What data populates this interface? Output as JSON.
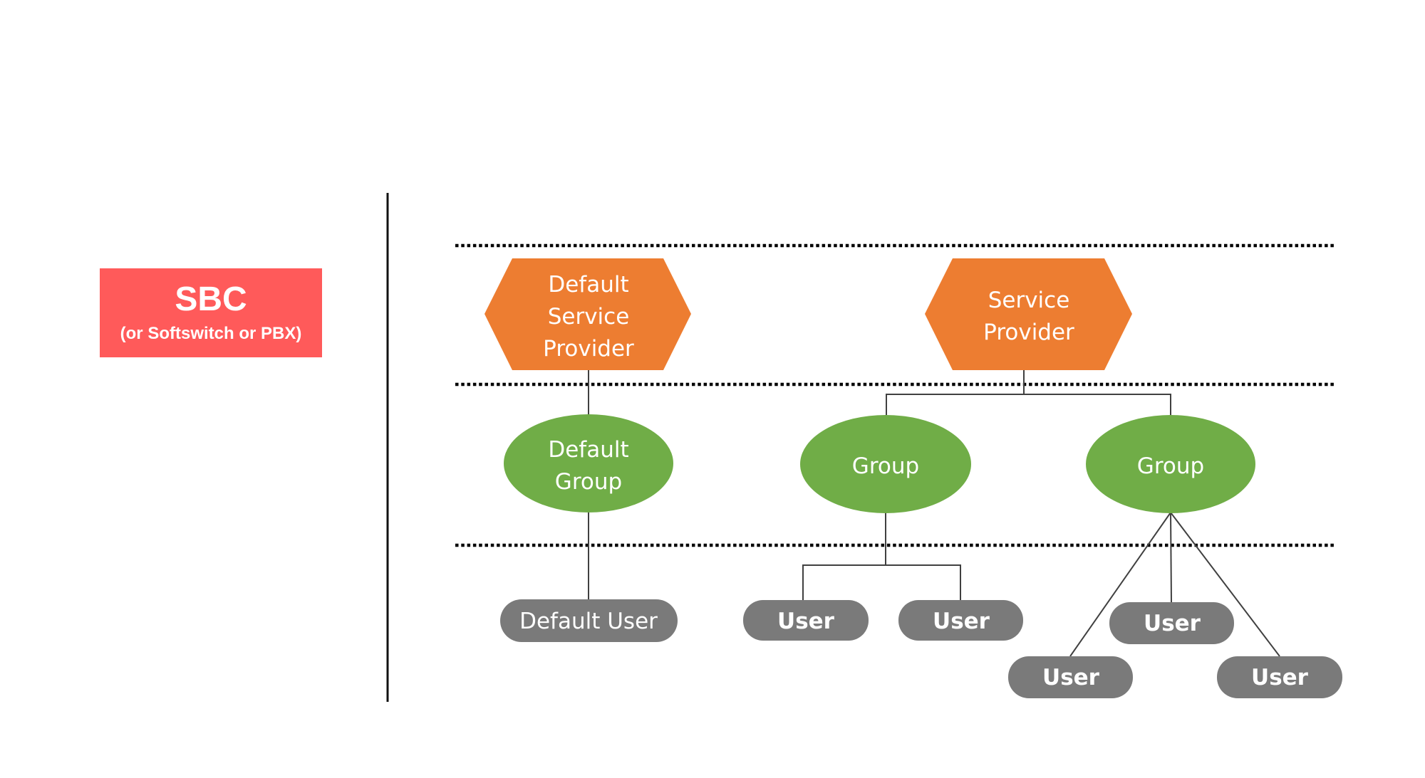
{
  "sbc": {
    "title": "SBC",
    "subtitle": "(or Softswitch or PBX)"
  },
  "colors": {
    "sbc": "#ff5a5a",
    "service_provider": "#ed7d31",
    "group": "#70ad47",
    "user": "#7a7a7a",
    "connector": "#404040",
    "separator": "#000000"
  },
  "tiers": [
    "service-provider",
    "group",
    "user"
  ],
  "service_providers": [
    {
      "id": "dsp",
      "lines": [
        "Default",
        "Service",
        "Provider"
      ]
    },
    {
      "id": "sp",
      "lines": [
        "Service",
        "Provider"
      ]
    }
  ],
  "groups": [
    {
      "id": "dg",
      "parent": "dsp",
      "lines": [
        "Default",
        "Group"
      ]
    },
    {
      "id": "g1",
      "parent": "sp",
      "lines": [
        "Group"
      ]
    },
    {
      "id": "g2",
      "parent": "sp",
      "lines": [
        "Group"
      ]
    }
  ],
  "users": [
    {
      "id": "du",
      "parent": "dg",
      "label": "Default User"
    },
    {
      "id": "u1",
      "parent": "g1",
      "label": "User"
    },
    {
      "id": "u2",
      "parent": "g1",
      "label": "User"
    },
    {
      "id": "u3",
      "parent": "g2",
      "label": "User"
    },
    {
      "id": "u4",
      "parent": "g2",
      "label": "User"
    },
    {
      "id": "u5",
      "parent": "g2",
      "label": "User"
    }
  ]
}
